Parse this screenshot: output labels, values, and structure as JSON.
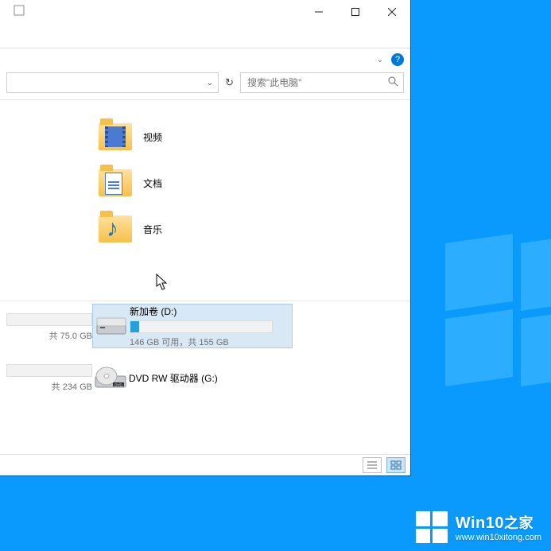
{
  "window": {
    "minimize_tooltip": "最小化",
    "maximize_tooltip": "还原",
    "close_tooltip": "关闭"
  },
  "help": {
    "symbol": "?"
  },
  "addressbar": {
    "dropdown_symbol": "⌄"
  },
  "toolbar": {
    "refresh_symbol": "↻"
  },
  "search": {
    "placeholder": "搜索\"此电脑\""
  },
  "folders": {
    "videos": {
      "label": "视频"
    },
    "documents": {
      "label": "文档"
    },
    "music": {
      "label": "音乐"
    }
  },
  "drives": {
    "partial1": {
      "subtext": "共 75.0 GB"
    },
    "partial2": {
      "subtext": "共 234 GB"
    },
    "d": {
      "title": "新加卷 (D:)",
      "subtext": "146 GB 可用，共 155 GB",
      "fill_percent": 6
    },
    "dvd": {
      "title": "DVD RW 驱动器 (G:)"
    }
  },
  "watermark": {
    "brand_en": "Win10",
    "brand_zh": "之家",
    "url": "www.win10xitong.com"
  },
  "colors": {
    "accent": "#0078d7",
    "desktop": "#0a9afe",
    "selection": "#d9e8f5"
  }
}
